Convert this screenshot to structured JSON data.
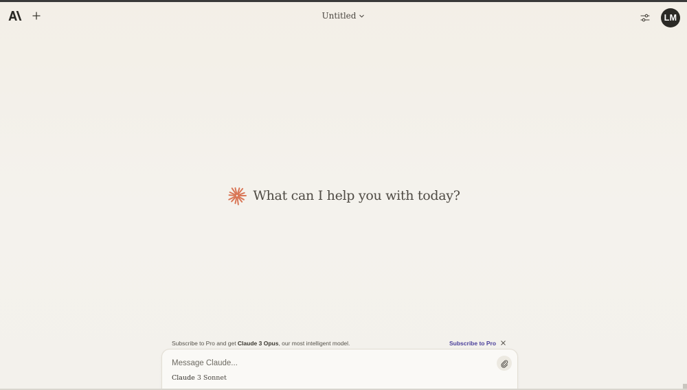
{
  "header": {
    "title": "Untitled",
    "logo_icon": "anthropic-logo-icon",
    "new_chat_icon": "plus-icon",
    "settings_icon": "sliders-icon",
    "avatar_initials": "LM"
  },
  "hero": {
    "heading": "What can I help you with today?",
    "icon": "claude-starburst-icon",
    "accent_color": "#d97757"
  },
  "promo": {
    "prefix": "Subscribe to Pro and get ",
    "highlight": "Claude 3 Opus",
    "suffix": ", our most intelligent model.",
    "link_label": "Subscribe to Pro",
    "link_color": "#4a3f9a"
  },
  "composer": {
    "placeholder": "Message Claude...",
    "value": "",
    "model_brand": "Claude",
    "model_version": "3 Sonnet",
    "attach_icon": "paperclip-icon"
  }
}
